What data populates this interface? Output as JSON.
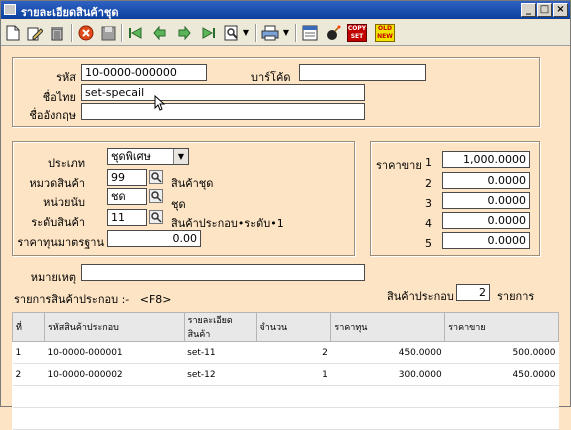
{
  "window": {
    "title": "รายละเอียดสินค้าชุด"
  },
  "toolbar_icons": [
    "new-icon",
    "edit-icon",
    "trash-icon",
    "cancel-icon",
    "save-icon",
    "first-icon",
    "prev-icon",
    "next-icon",
    "last-icon",
    "search-icon",
    "dropdown-icon",
    "print-icon",
    "dropdown-icon",
    "note-icon",
    "bomb-icon",
    "copy-set-icon",
    "old-new-icon"
  ],
  "toolbar": {
    "copy_top": "COPY",
    "copy_bottom": "SET",
    "old_top": "OLD",
    "old_bottom": "NEW"
  },
  "header": {
    "code_label": "รหัส",
    "code_value": "10-0000-000000",
    "barcode_label": "บาร์โค้ด",
    "barcode_value": "",
    "thai_name_label": "ชื่อไทย",
    "thai_name_value": "set-specail",
    "eng_name_label": "ชื่ออังกฤษ",
    "eng_name_value": ""
  },
  "details": {
    "type_label": "ประเภท",
    "type_value": "ชุดพิเศษ",
    "category_label": "หมวดสินค้า",
    "category_value": "99",
    "category_desc": "สินค้าชุด",
    "unit_label": "หน่วยนับ",
    "unit_value": "ชด",
    "unit_desc": "ชุด",
    "level_label": "ระดับสินค้า",
    "level_value": "11",
    "level_desc": "สินค้าประกอบ•ระดับ•1",
    "stdcost_label": "ราคาทุนมาตรฐาน",
    "stdcost_value": "0.00"
  },
  "prices": {
    "label": "ราคาขาย",
    "levels": [
      {
        "n": "1",
        "value": "1,000.0000"
      },
      {
        "n": "2",
        "value": "0.0000"
      },
      {
        "n": "3",
        "value": "0.0000"
      },
      {
        "n": "4",
        "value": "0.0000"
      },
      {
        "n": "5",
        "value": "0.0000"
      }
    ]
  },
  "remark": {
    "label": "หมายเหตุ",
    "value": ""
  },
  "components": {
    "title": "รายการสินค้าประกอบ :-   <F8>",
    "count_label": "สินค้าประกอบ",
    "count_value": "2",
    "count_unit": "รายการ",
    "columns": [
      "ที่",
      "รหัสสินค้าประกอบ",
      "รายละเอียดสินค้า",
      "จำนวน",
      "ราคาทุน",
      "ราคาขาย"
    ],
    "rows": [
      [
        "1",
        "10-0000-000001",
        "set-11",
        "2",
        "450.0000",
        "500.0000"
      ],
      [
        "2",
        "10-0000-000002",
        "set-12",
        "1",
        "300.0000",
        "450.0000"
      ]
    ]
  }
}
